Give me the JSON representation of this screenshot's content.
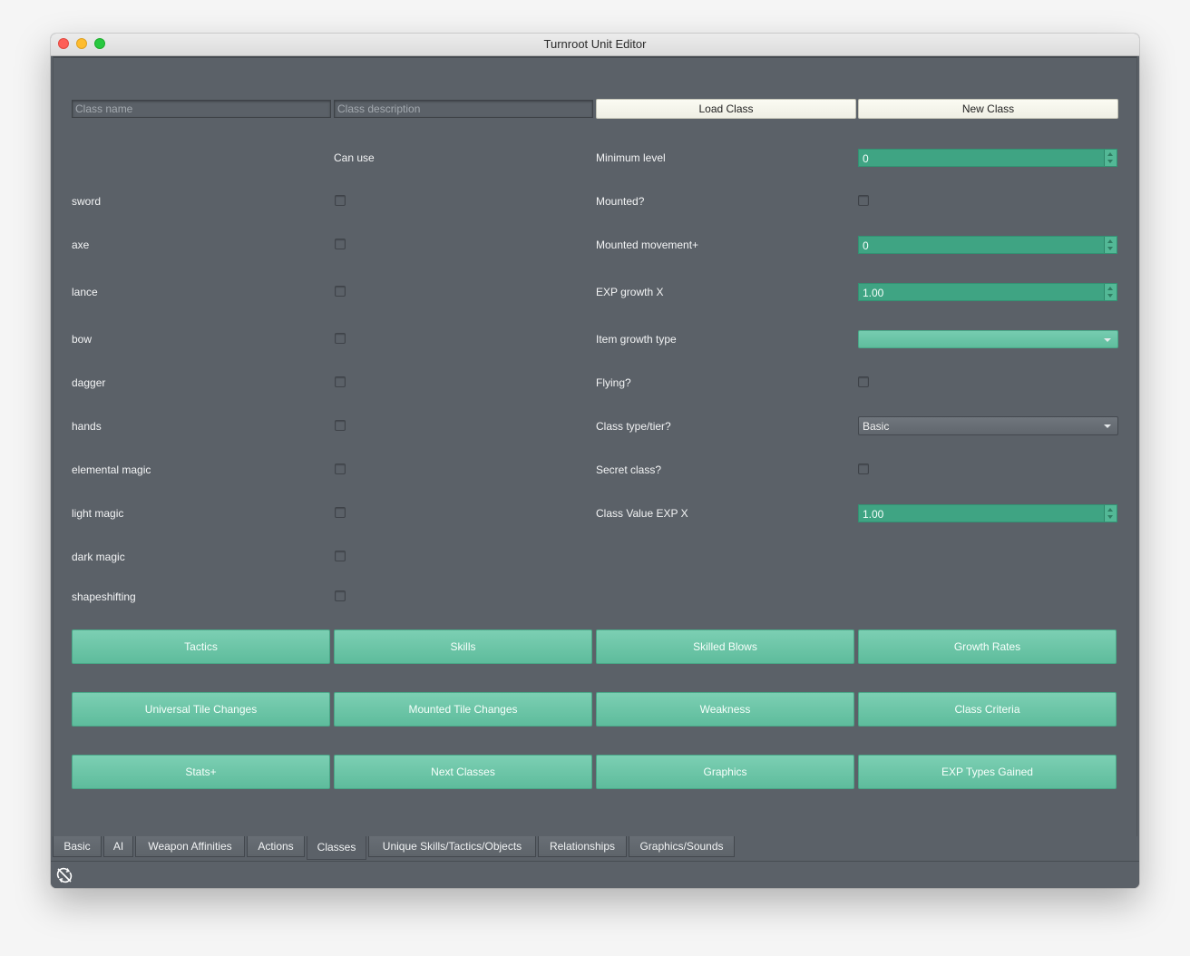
{
  "window": {
    "title": "Turnroot Unit Editor"
  },
  "header": {
    "class_name_placeholder": "Class name",
    "class_description_placeholder": "Class description",
    "load_button": "Load Class",
    "new_button": "New Class"
  },
  "weapons": {
    "column_header": "Can use",
    "items": [
      {
        "label": "sword",
        "checked": false
      },
      {
        "label": "axe",
        "checked": false
      },
      {
        "label": "lance",
        "checked": false
      },
      {
        "label": "bow",
        "checked": false
      },
      {
        "label": "dagger",
        "checked": false
      },
      {
        "label": "hands",
        "checked": false
      },
      {
        "label": "elemental magic",
        "checked": false
      },
      {
        "label": "light magic",
        "checked": false
      },
      {
        "label": "dark magic",
        "checked": false
      },
      {
        "label": "shapeshifting",
        "checked": false
      }
    ]
  },
  "properties": {
    "minimum_level": {
      "label": "Minimum level",
      "value": "0"
    },
    "mounted": {
      "label": "Mounted?",
      "checked": false
    },
    "mounted_movement": {
      "label": "Mounted movement+",
      "value": "0"
    },
    "exp_growth": {
      "label": "EXP growth X",
      "value": "1.00"
    },
    "item_growth_type": {
      "label": "Item growth type",
      "value": ""
    },
    "flying": {
      "label": "Flying?",
      "checked": false
    },
    "class_type": {
      "label": "Class type/tier?",
      "value": "Basic"
    },
    "secret_class": {
      "label": "Secret class?",
      "checked": false
    },
    "class_value_exp": {
      "label": "Class Value EXP X",
      "value": "1.00"
    }
  },
  "buttons": {
    "row1": [
      "Tactics",
      "Skills",
      "Skilled Blows",
      "Growth Rates"
    ],
    "row2": [
      "Universal Tile Changes",
      "Mounted Tile Changes",
      "Weakness",
      "Class Criteria"
    ],
    "row3": [
      "Stats+",
      "Next Classes",
      "Graphics",
      "EXP Types Gained"
    ]
  },
  "tabs": [
    "Basic",
    "AI",
    "Weapon Affinities",
    "Actions",
    "Classes",
    "Unique Skills/Tactics/Objects",
    "Relationships",
    "Graphics/Sounds"
  ],
  "active_tab": "Classes",
  "colors": {
    "background": "#5b6168",
    "accent_green": "#3fa483",
    "button_green": "#6cc6a8",
    "text": "#f3f4f5"
  },
  "icons": {
    "status_icon": "refresh-crossed-icon"
  }
}
